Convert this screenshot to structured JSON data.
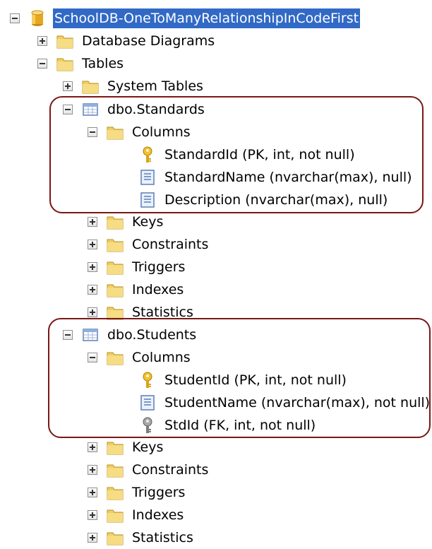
{
  "tree": {
    "database": "SchoolDB-OneToManyRelationshipInCodeFirst",
    "database_diagrams": "Database Diagrams",
    "tables": "Tables",
    "system_tables": "System Tables",
    "standards": {
      "name": "dbo.Standards",
      "columns_label": "Columns",
      "columns": [
        {
          "text": "StandardId (PK, int, not null)",
          "icon": "primary-key-icon"
        },
        {
          "text": "StandardName (nvarchar(max), null)",
          "icon": "column-icon"
        },
        {
          "text": "Description (nvarchar(max), null)",
          "icon": "column-icon"
        }
      ],
      "folders": [
        "Keys",
        "Constraints",
        "Triggers",
        "Indexes",
        "Statistics"
      ]
    },
    "students": {
      "name": "dbo.Students",
      "columns_label": "Columns",
      "columns": [
        {
          "text": "StudentId (PK, int, not null)",
          "icon": "primary-key-icon"
        },
        {
          "text": "StudentName (nvarchar(max), not null)",
          "icon": "column-icon"
        },
        {
          "text": "StdId (FK, int, not null)",
          "icon": "foreign-key-icon"
        }
      ],
      "folders": [
        "Keys",
        "Constraints",
        "Triggers",
        "Indexes",
        "Statistics"
      ]
    }
  },
  "colors": {
    "selection": "#3169c6",
    "highlight_border": "#7b1616",
    "folder": "#f1cf5e"
  }
}
